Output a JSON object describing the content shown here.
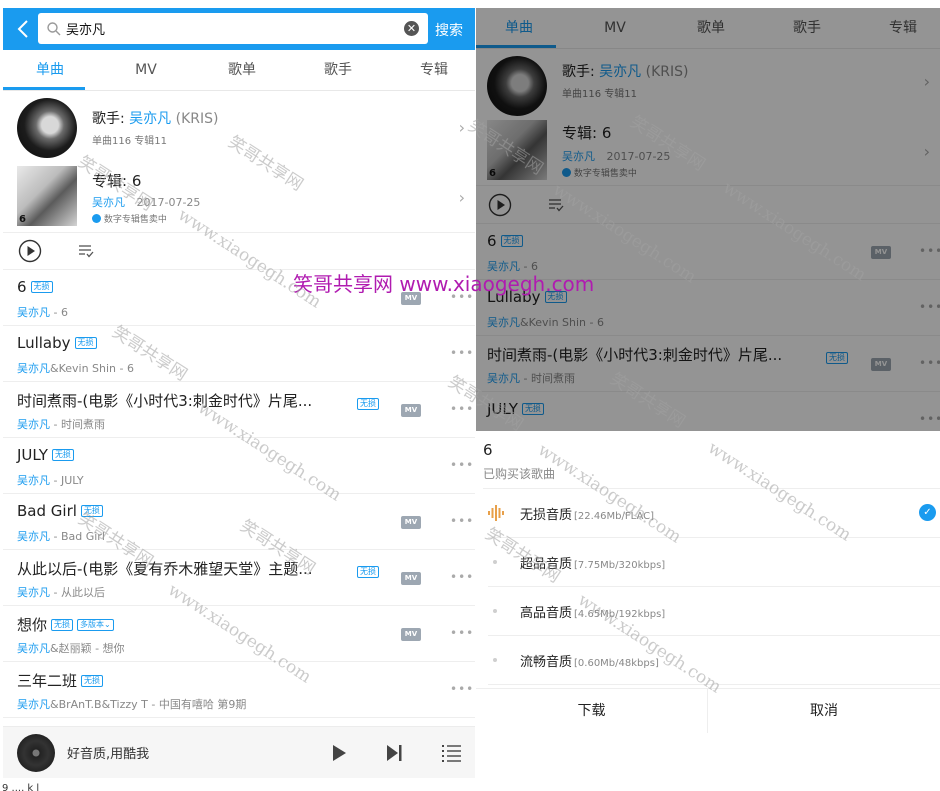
{
  "search": {
    "query": "吴亦凡",
    "button": "搜索"
  },
  "tabs": [
    "单曲",
    "MV",
    "歌单",
    "歌手",
    "专辑"
  ],
  "artist": {
    "prefix": "歌手:",
    "name": "吴亦凡",
    "alias": "(KRIS)",
    "stats": "单曲116 专辑11"
  },
  "album": {
    "prefix": "专辑:",
    "title": "6",
    "artist": "吴亦凡",
    "date": "2017-07-25",
    "status": "数字专辑售卖中",
    "cover_text": "6"
  },
  "badges": {
    "lossless": "无损",
    "multi_version": "多版本"
  },
  "mv_label": "MV",
  "songs": [
    {
      "title": "6",
      "artist": "吴亦凡",
      "extra": " - 6",
      "mv": true
    },
    {
      "title": "Lullaby",
      "artist": "吴亦凡",
      "extra": "&Kevin Shin - 6",
      "mv": false
    },
    {
      "title": "时间煮雨-(电影《小时代3:刺金时代》片尾...",
      "artist": "吴亦凡",
      "extra": " - 时间煮雨",
      "mv": true
    },
    {
      "title": "JULY",
      "artist": "吴亦凡",
      "extra": " - JULY",
      "mv": false
    },
    {
      "title": "Bad Girl",
      "artist": "吴亦凡",
      "extra": " - Bad Girl",
      "mv": true
    },
    {
      "title": "从此以后-(电影《夏有乔木雅望天堂》主题...",
      "artist": "吴亦凡",
      "extra": " - 从此以后",
      "mv": true
    },
    {
      "title": "想你",
      "artist": "吴亦凡",
      "extra": "&赵丽颖 - 想你",
      "mv": true
    },
    {
      "title": "三年二班",
      "artist": "吴亦凡",
      "extra": "&BrAnT.B&Tizzy T - 中国有嘻哈 第9期",
      "mv": false
    }
  ],
  "player": {
    "text": "好音质,用酷我"
  },
  "sheet": {
    "title": "6",
    "subtitle": "已购买该歌曲",
    "qualities": [
      {
        "name": "无损音质",
        "info": "[22.46Mb/FLAC]"
      },
      {
        "name": "超品音质",
        "info": "[7.75Mb/320kbps]"
      },
      {
        "name": "高品音质",
        "info": "[4.65Mb/192kbps]"
      },
      {
        "name": "流畅音质",
        "info": "[0.60Mb/48kbps]"
      }
    ],
    "download": "下载",
    "cancel": "取消"
  },
  "watermark": {
    "main": "笑哥共享网  www.xiaogegh.com",
    "cn": "笑哥共享网",
    "url": "www.xiaogegh.com"
  },
  "footer": "9 .... k  l",
  "colors": {
    "accent": "#1a9bef",
    "watermark_main": "#b01bb0",
    "mv_badge": "#9da7b2"
  }
}
